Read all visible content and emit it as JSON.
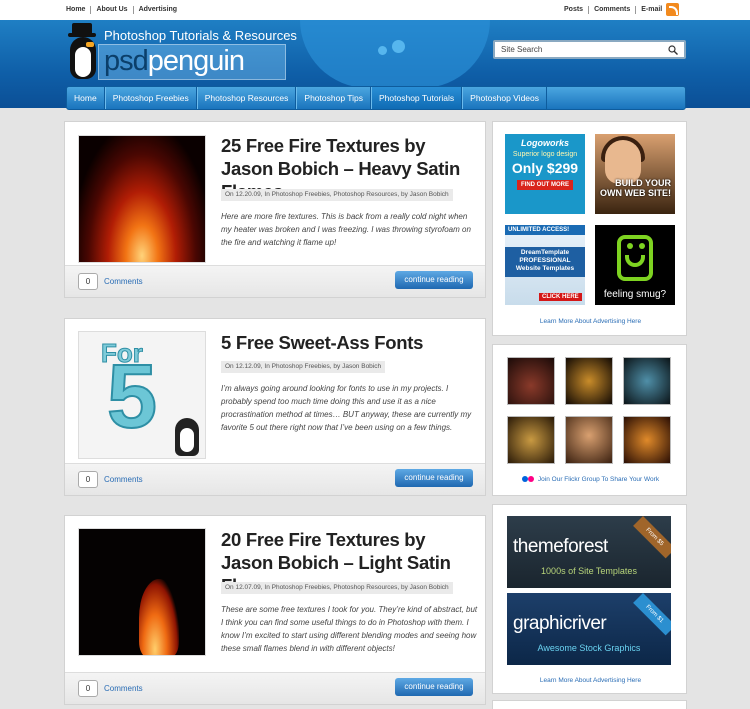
{
  "topbar": {
    "left_links": [
      "Home",
      "About Us",
      "Advertising"
    ],
    "right_links": [
      "Posts",
      "Comments",
      "E-mail"
    ],
    "rss_icon": "rss-icon"
  },
  "header": {
    "tagline": "Photoshop Tutorials & Resources",
    "logo_psd": "psd",
    "logo_penguin": "penguin",
    "search_placeholder": "Site Search"
  },
  "nav": {
    "items": [
      "Home",
      "Photoshop Freebies",
      "Photoshop Resources",
      "Photoshop Tips",
      "Photoshop Tutorials",
      "Photoshop Videos"
    ],
    "active_index": 4
  },
  "posts": [
    {
      "title": "25 Free Fire Textures by Jason Bobich – Heavy Satin Flames",
      "meta": "On 12.20.09, In Photoshop Freebies, Photoshop Resources, by Jason Bobich",
      "excerpt": "Here are more fire textures. This is back from a really cold night when my heater was broken and I was freezing. I was throwing styrofoam on the fire and watching it flame up!",
      "comment_count": "0",
      "comments_label": "Comments",
      "button_label": "continue reading"
    },
    {
      "title": "5 Free Sweet-Ass Fonts",
      "meta": "On 12.12.09, In Photoshop Freebies, by Jason Bobich",
      "excerpt": "I’m always going around looking for fonts to use in my projects. I probably spend too much time doing this and use it as a nice procrastination method at times… BUT anyway, these are currently my favorite 5 out there right now that I’ve been using on a few things.",
      "comment_count": "0",
      "comments_label": "Comments",
      "button_label": "continue reading",
      "thumb_word": "For",
      "thumb_number": "5"
    },
    {
      "title": "20 Free Fire Textures by Jason Bobich – Light Satin Flames",
      "meta": "On 12.07.09, In Photoshop Freebies, Photoshop Resources, by Jason Bobich",
      "excerpt": "These are some free textures I took for you. They’re kind of abstract, but I think you can find some useful things to do in Photoshop with them. I know I’m excited to start using different blending modes and seeing how these small flames blend in with different objects!",
      "comment_count": "0",
      "comments_label": "Comments",
      "button_label": "continue reading"
    }
  ],
  "sidebar": {
    "ads": {
      "logoworks": {
        "brand": "Logoworks",
        "line1": "Superior logo design",
        "price": "Only $299",
        "cta": "FIND OUT MORE"
      },
      "website": {
        "lines": [
          "BUILD YOUR",
          "OWN WEB SITE!"
        ]
      },
      "dreamtemplate": {
        "top": "UNLIMITED ACCESS!",
        "brand": "DreamTemplate",
        "line1": "PROFESSIONAL",
        "line2": "Website Templates",
        "cta": "CLICK HERE"
      },
      "smug": {
        "label": "feeling smug?"
      }
    },
    "ads_link": "Learn More About Advertising Here",
    "flickr_link": "Join Our Flickr Group To Share Your Work",
    "market": {
      "themeforest": {
        "name": "themeforest",
        "sub": "1000s of Site Templates",
        "ribbon": "From $5"
      },
      "graphicriver": {
        "name": "graphicriver",
        "sub": "Awesome Stock Graphics",
        "ribbon": "From $1"
      }
    },
    "market_link": "Learn More About Advertising Here"
  },
  "colors": {
    "header_blue": "#1674bd",
    "link_blue": "#2a6db5",
    "button_blue": "#1f68b1",
    "rss_orange": "#f28a1e"
  }
}
